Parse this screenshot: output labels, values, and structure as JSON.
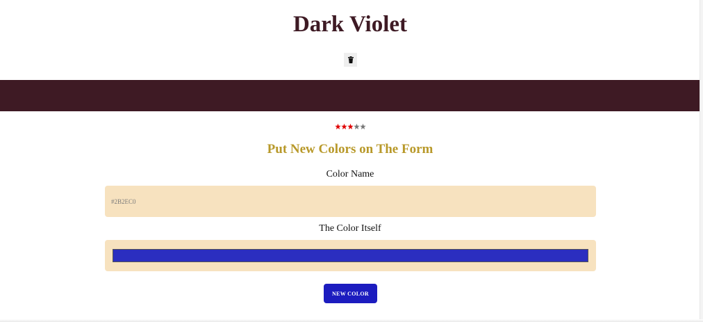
{
  "header": {
    "title": "Dark Violet",
    "delete_icon": "trash-icon"
  },
  "band": {
    "color": "#3e1a24"
  },
  "rating": {
    "filled": 3,
    "total": 5,
    "filled_color": "#e00000",
    "empty_color": "#777777",
    "icon": "star-icon"
  },
  "form": {
    "heading": "Put New Colors on The Form",
    "heading_color": "#b8992a",
    "field_background": "#f7e2bf",
    "color_name_label": "Color Name",
    "color_name_placeholder": "#2B2EC0",
    "color_itself_label": "The Color Itself",
    "color_value": "#2b2ec0",
    "submit_label": "NEW COLOR",
    "submit_color": "#1c1cbf"
  }
}
